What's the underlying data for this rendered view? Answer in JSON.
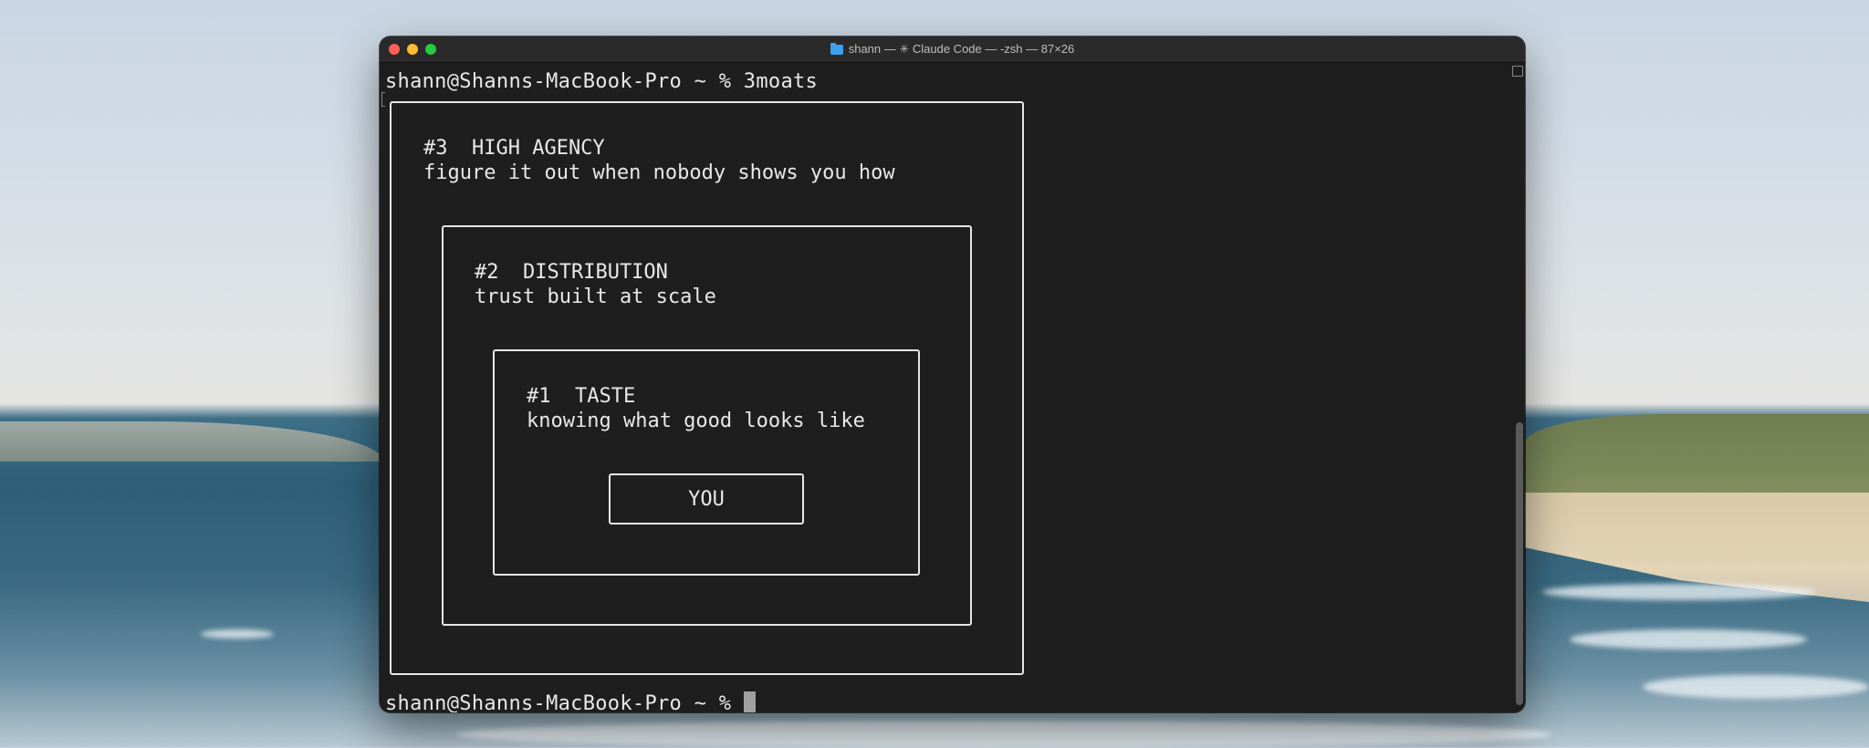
{
  "window": {
    "title": "shann — ✳ Claude Code — -zsh — 87×26"
  },
  "terminal": {
    "prompt_line_1": "shann@Shanns-MacBook-Pro ~ % 3moats",
    "prompt_line_2": "shann@Shanns-MacBook-Pro ~ % "
  },
  "moats": [
    {
      "heading": "#3  HIGH AGENCY",
      "description": "figure it out when nobody shows you how"
    },
    {
      "heading": "#2  DISTRIBUTION",
      "description": "trust built at scale"
    },
    {
      "heading": "#1  TASTE",
      "description": "knowing what good looks like"
    }
  ],
  "center_label": "YOU",
  "icons": {
    "folder": "folder-icon",
    "close": "close-icon",
    "minimize": "minimize-icon",
    "zoom": "zoom-icon"
  },
  "colors": {
    "terminal_bg": "#1e1e1e",
    "text": "#e8e8e8",
    "close": "#ff5f57",
    "minimize": "#febc2e",
    "zoom": "#28c840"
  }
}
